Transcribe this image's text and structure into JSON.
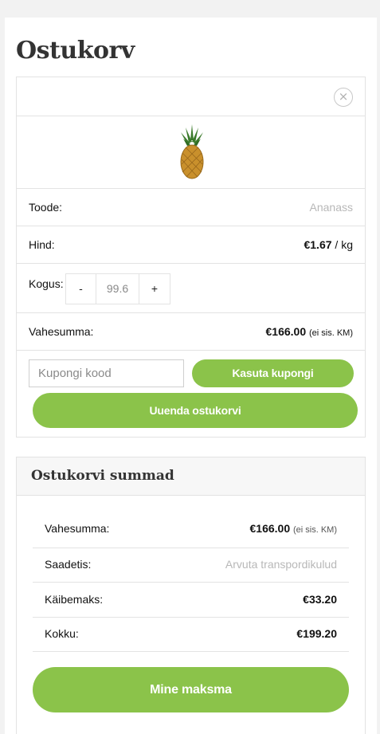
{
  "page": {
    "title": "Ostukorv"
  },
  "cart": {
    "remove_glyph": "×",
    "product_image": "pineapple-image",
    "product_label": "Toode:",
    "product_value": "Ananass",
    "price_label": "Hind:",
    "price_value": "€1.67",
    "price_unit": " / kg",
    "quantity_label": "Kogus:",
    "quantity_minus": "-",
    "quantity_value": "99.6",
    "quantity_plus": "+",
    "subtotal_label": "Vahesumma:",
    "subtotal_value": "€166.00",
    "subtotal_note": "(ei sis. KM)",
    "coupon_placeholder": "Kupongi kood",
    "apply_coupon_label": "Kasuta kupongi",
    "update_cart_label": "Uuenda ostukorvi"
  },
  "totals": {
    "heading": "Ostukorvi summad",
    "subtotal_label": "Vahesumma:",
    "subtotal_value": "€166.00",
    "subtotal_note": "(ei sis. KM)",
    "shipping_label": "Saadetis:",
    "shipping_value": "Arvuta transpordikulud",
    "tax_label": "Käibemaks:",
    "tax_value": "€33.20",
    "total_label": "Kokku:",
    "total_value": "€199.20",
    "checkout_label": "Mine maksma"
  },
  "colors": {
    "accent": "#8bc34a",
    "border": "#e3e3e3",
    "muted": "#b8b8b8",
    "heading": "#333333"
  }
}
